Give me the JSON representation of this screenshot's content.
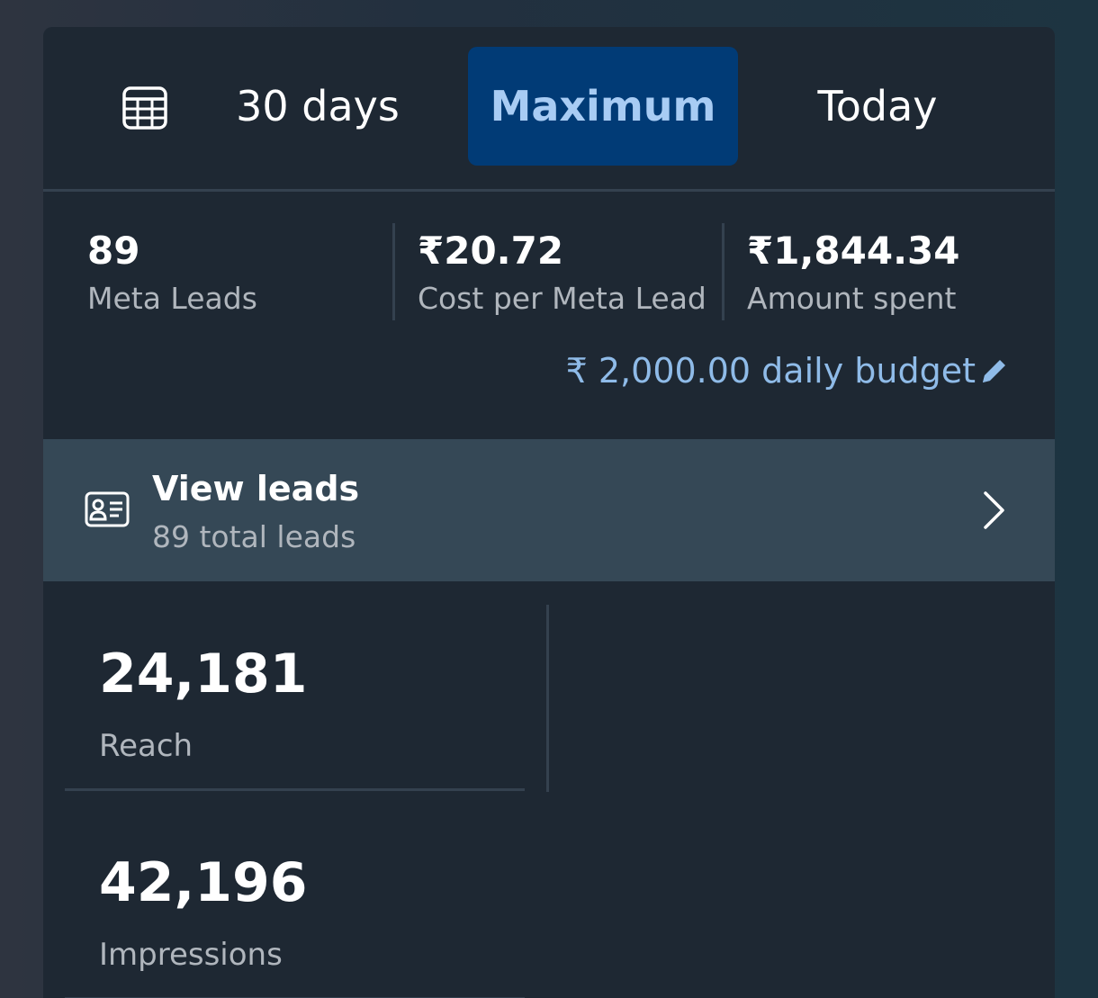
{
  "range_selector": {
    "calendar_icon": "calendar-icon",
    "options": [
      {
        "label": "30 days",
        "selected": false
      },
      {
        "label": "Maximum",
        "selected": true
      },
      {
        "label": "Today",
        "selected": false
      }
    ]
  },
  "metrics": [
    {
      "value": "89",
      "label": "Meta Leads"
    },
    {
      "value": "₹20.72",
      "label": "Cost per Meta Lead"
    },
    {
      "value": "₹1,844.34",
      "label": "Amount spent"
    }
  ],
  "budget": {
    "text": "₹ 2,000.00 daily budget",
    "icon": "pencil-icon"
  },
  "view_leads": {
    "icon": "contact-card-icon",
    "title": "View leads",
    "subtitle": "89 total leads",
    "chevron": "chevron-right-icon"
  },
  "stats": [
    {
      "value": "24,181",
      "label": "Reach"
    },
    {
      "value": "42,196",
      "label": "Impressions"
    }
  ],
  "colors": {
    "card_bg": "#1e2833",
    "selected_bg": "#013b76",
    "selected_text": "#a8ccf4",
    "link": "#8fbbe8",
    "leads_row_bg": "#354856"
  }
}
